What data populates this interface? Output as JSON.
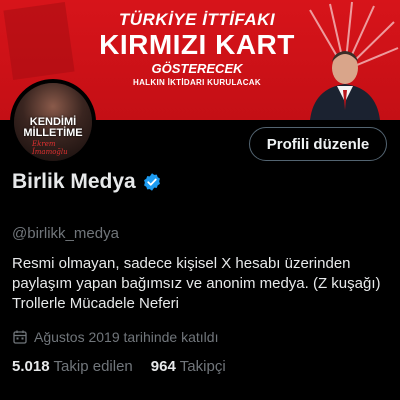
{
  "banner": {
    "line1": "TÜRKİYE İTTİFAKI",
    "line2": "KIRMIZI KART",
    "line3": "GÖSTERECEK",
    "line4": "HALKIN İKTİDARI KURULACAK"
  },
  "avatar": {
    "line1": "KENDİMİ",
    "line2": "MİLLETİME",
    "signature": "Ekrem İmamoğlu"
  },
  "actions": {
    "edit_profile": "Profili düzenle"
  },
  "profile": {
    "name": "Birlik Medya",
    "handle": "@birlikk_medya",
    "bio_line1": "Resmi olmayan, sadece kişisel X hesabı üzerinden",
    "bio_line2": "paylaşım yapan bağımsız ve anonim medya. (Z kuşağı)",
    "bio_line3": "Trollerle Mücadele Neferi",
    "joined": "Ağustos 2019 tarihinde katıldı"
  },
  "stats": {
    "following_count": "5.018",
    "following_label": "Takip edilen",
    "followers_count": "964",
    "followers_label": "Takipçi"
  },
  "colors": {
    "accent": "#1d9bf0",
    "banner_red": "#d7141a"
  }
}
